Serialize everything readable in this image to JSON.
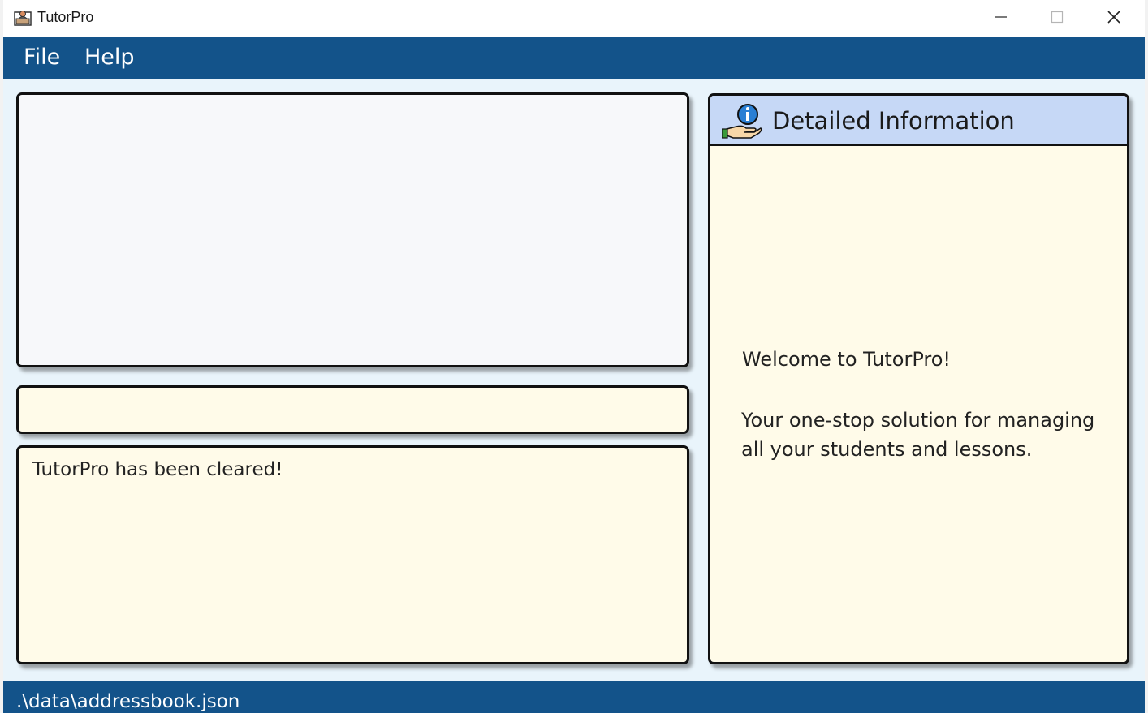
{
  "window": {
    "title": "TutorPro",
    "minimize_icon": "minimize-icon",
    "maximize_icon": "maximize-icon",
    "close_icon": "close-icon"
  },
  "menu": {
    "items": [
      {
        "label": "File"
      },
      {
        "label": "Help"
      }
    ]
  },
  "command": {
    "value": "",
    "placeholder": ""
  },
  "result": {
    "text": "TutorPro has been cleared!"
  },
  "details": {
    "title": "Detailed Information",
    "icon": "info-hand-icon",
    "welcome": "Welcome to TutorPro!",
    "tagline": "Your one-stop solution for managing all your students and lessons."
  },
  "status": {
    "path": ".\\data\\addressbook.json"
  },
  "colors": {
    "menu_bg": "#13538a",
    "detail_header_bg": "#c6d8f6",
    "panel_bg": "#fffbe9",
    "window_bg": "#e9f4fb"
  }
}
